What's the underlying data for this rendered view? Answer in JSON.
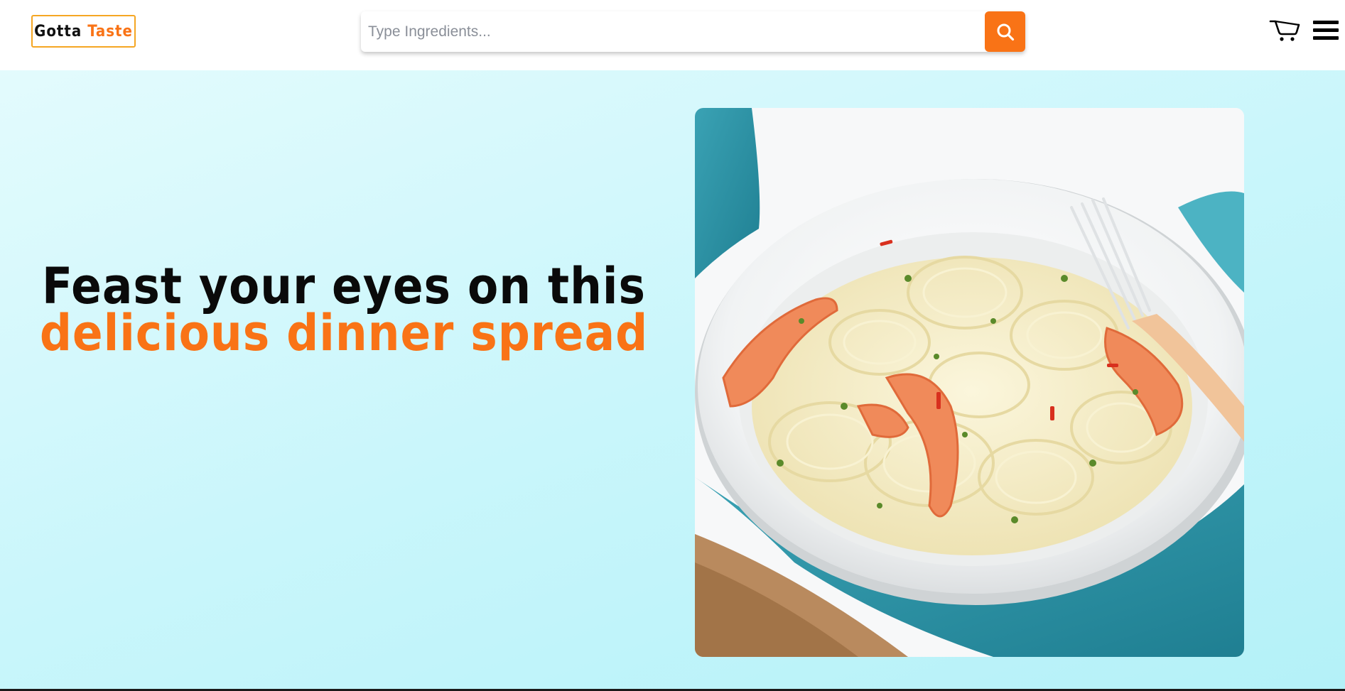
{
  "app": {
    "logo": {
      "word1": "Gotta",
      "word2": "Taste"
    }
  },
  "search": {
    "placeholder": "Type Ingredients...",
    "value": ""
  },
  "header": {
    "icons": [
      "search-icon",
      "cart-icon",
      "hamburger-menu-icon"
    ]
  },
  "hero": {
    "headline_line1": "Feast your eyes on this",
    "headline_line2": "delicious dinner spread",
    "image_subject": "shrimp-linguine-dish"
  },
  "colors": {
    "accent": "#f97316",
    "logo_border": "#f5a623",
    "hero_bg_light": "#e3fbfd",
    "hero_bg_dark": "#b4f1f8",
    "text_dark": "#0a0a0a"
  }
}
